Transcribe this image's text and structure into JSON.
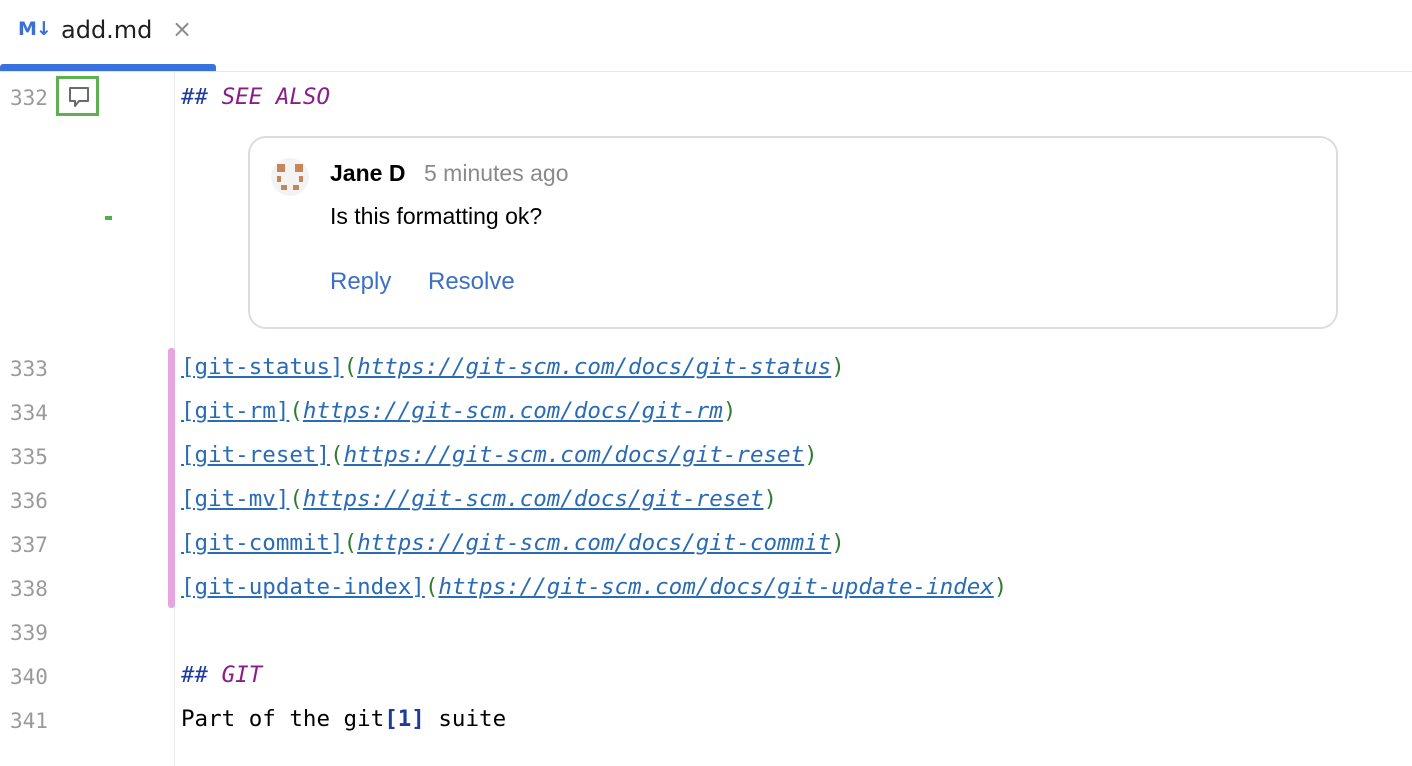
{
  "tab": {
    "icon": "M↓",
    "label": "add.md",
    "close": "×"
  },
  "comment": {
    "author": "Jane D",
    "time": "5 minutes ago",
    "body": "Is this formatting ok?",
    "reply_label": "Reply",
    "resolve_label": "Resolve"
  },
  "lines": {
    "n332": "332",
    "n333": "333",
    "n334": "334",
    "n335": "335",
    "n336": "336",
    "n337": "337",
    "n338": "338",
    "n339": "339",
    "n340": "340",
    "n341": "341"
  },
  "code": {
    "see_also_hash": "##",
    "see_also_text": "SEE ALSO",
    "links": [
      {
        "label": "[git-status]",
        "url": "https://git-scm.com/docs/git-status"
      },
      {
        "label": "[git-rm]",
        "url": "https://git-scm.com/docs/git-rm"
      },
      {
        "label": "[git-reset]",
        "url": "https://git-scm.com/docs/git-reset"
      },
      {
        "label": "[git-mv]",
        "url": "https://git-scm.com/docs/git-reset"
      },
      {
        "label": "[git-commit]",
        "url": "https://git-scm.com/docs/git-commit"
      },
      {
        "label": "[git-update-index]",
        "url": "https://git-scm.com/docs/git-update-index"
      }
    ],
    "git_hash": "##",
    "git_text": "GIT",
    "suite_pre": "Part of the git",
    "suite_ref": "[1]",
    "suite_post": " suite"
  },
  "colors": {
    "accent": "#3871e0",
    "link": "#2a6bb5",
    "heading": "#8a1d8a",
    "change_marker": "#e6a5e0",
    "comment_marker": "#5fb053"
  }
}
